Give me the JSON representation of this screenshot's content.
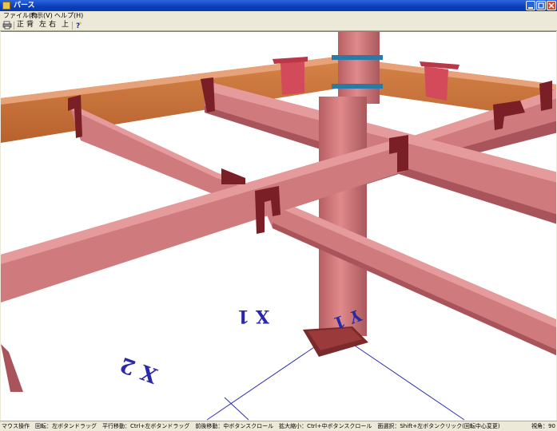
{
  "window": {
    "title": "パース",
    "icon": "app-icon"
  },
  "title_buttons": [
    {
      "name": "minimize-icon"
    },
    {
      "name": "maximize-icon"
    },
    {
      "name": "close-icon"
    }
  ],
  "menu": {
    "items": [
      {
        "label": "ファイル(F)"
      },
      {
        "label": "表示(V)"
      },
      {
        "label": "ヘルプ(H)"
      }
    ]
  },
  "toolbar": {
    "print_icon": "printer-icon",
    "views": [
      {
        "label": "正"
      },
      {
        "label": "背"
      },
      {
        "label": "左"
      },
      {
        "label": "右"
      },
      {
        "label": "上"
      }
    ],
    "help_icon": "help-icon"
  },
  "viewport": {
    "axis_labels": [
      {
        "text": "X 1"
      },
      {
        "text": "X 2"
      },
      {
        "text": "Y 1"
      }
    ],
    "colors": {
      "beam": "#d3787a",
      "beam_dark": "#8c3a3e",
      "orange_beam": "#c8703a",
      "gridline": "#3030b0",
      "axis_text": "#2a28a8"
    }
  },
  "status": {
    "text": "マウス操作　回転：左ボタンドラッグ　平行移動：Ctrl+左ボタンドラッグ　前後移動：中ボタンスクロール　拡大縮小：Ctrl+中ボタンスクロール　面選択：Shift+左ボタンクリック(回転中心変更)",
    "view_angle": "視角：90"
  }
}
